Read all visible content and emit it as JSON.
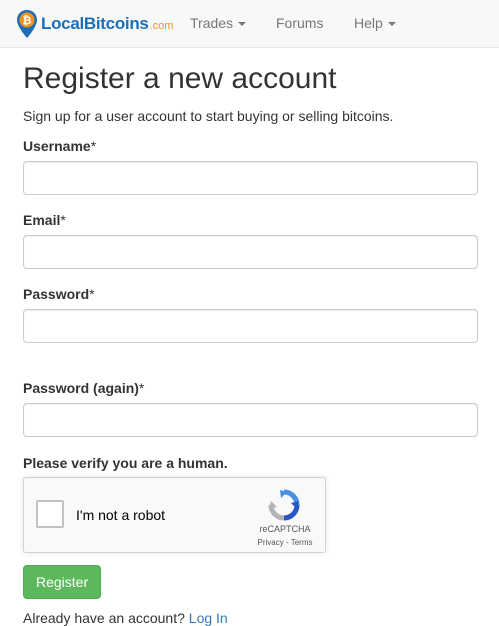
{
  "navbar": {
    "brand_name": "LocalBitcoins",
    "brand_suffix": ".com",
    "items": [
      {
        "label": "Trades",
        "has_dropdown": true
      },
      {
        "label": "Forums",
        "has_dropdown": false
      },
      {
        "label": "Help",
        "has_dropdown": true
      }
    ]
  },
  "page": {
    "title": "Register a new account",
    "subtitle": "Sign up for a user account to start buying or selling bitcoins."
  },
  "form": {
    "username": {
      "label": "Username",
      "required_mark": "*",
      "value": ""
    },
    "email": {
      "label": "Email",
      "required_mark": "*",
      "value": ""
    },
    "password": {
      "label": "Password",
      "required_mark": "*",
      "value": ""
    },
    "password_again": {
      "label": "Password (again)",
      "required_mark": "*",
      "value": ""
    },
    "verify_label": "Please verify you are a human.",
    "submit_label": "Register"
  },
  "captcha": {
    "checkbox_label": "I'm not a robot",
    "brand": "reCAPTCHA",
    "links": "Privacy - Terms"
  },
  "footer": {
    "login_prompt": "Already have an account?",
    "login_link": "Log In"
  },
  "colors": {
    "brand_blue": "#1d6fb8",
    "brand_orange": "#f7931a",
    "button_green": "#5cb85c",
    "link_blue": "#337ab7"
  },
  "icons": {
    "brand": "bitcoin-map-pin-icon",
    "dropdown": "caret-down-icon",
    "captcha": "recaptcha-icon"
  }
}
